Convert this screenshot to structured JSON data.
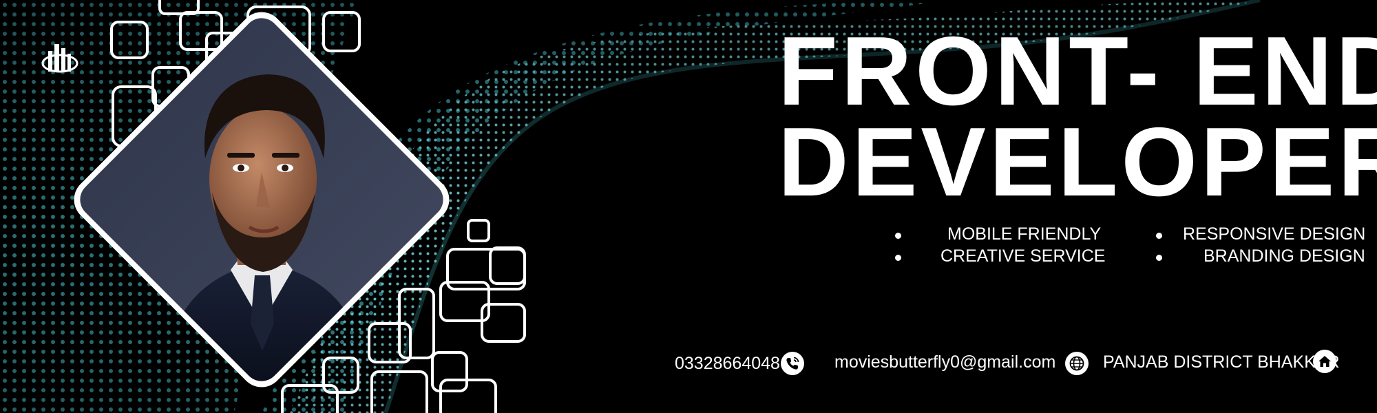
{
  "title": {
    "line1": "FRONT- END",
    "line2": "DEVELOPER"
  },
  "services": {
    "left": [
      "MOBILE FRIENDLY",
      "CREATIVE SERVICE"
    ],
    "right": [
      "RESPONSIVE  DESIGN",
      "BRANDING DESIGN"
    ]
  },
  "contact": {
    "phone": "03328664048",
    "email": "moviesbutterfly0@gmail.com",
    "address": "PANJAB DISTRICT BHAKKAR"
  },
  "icons": {
    "logo": "building-logo-icon",
    "phone": "phone-icon",
    "email": "globe-icon",
    "address": "home-icon"
  },
  "colors": {
    "background": "#000000",
    "accent": "#4fd6e0",
    "text": "#ffffff"
  }
}
